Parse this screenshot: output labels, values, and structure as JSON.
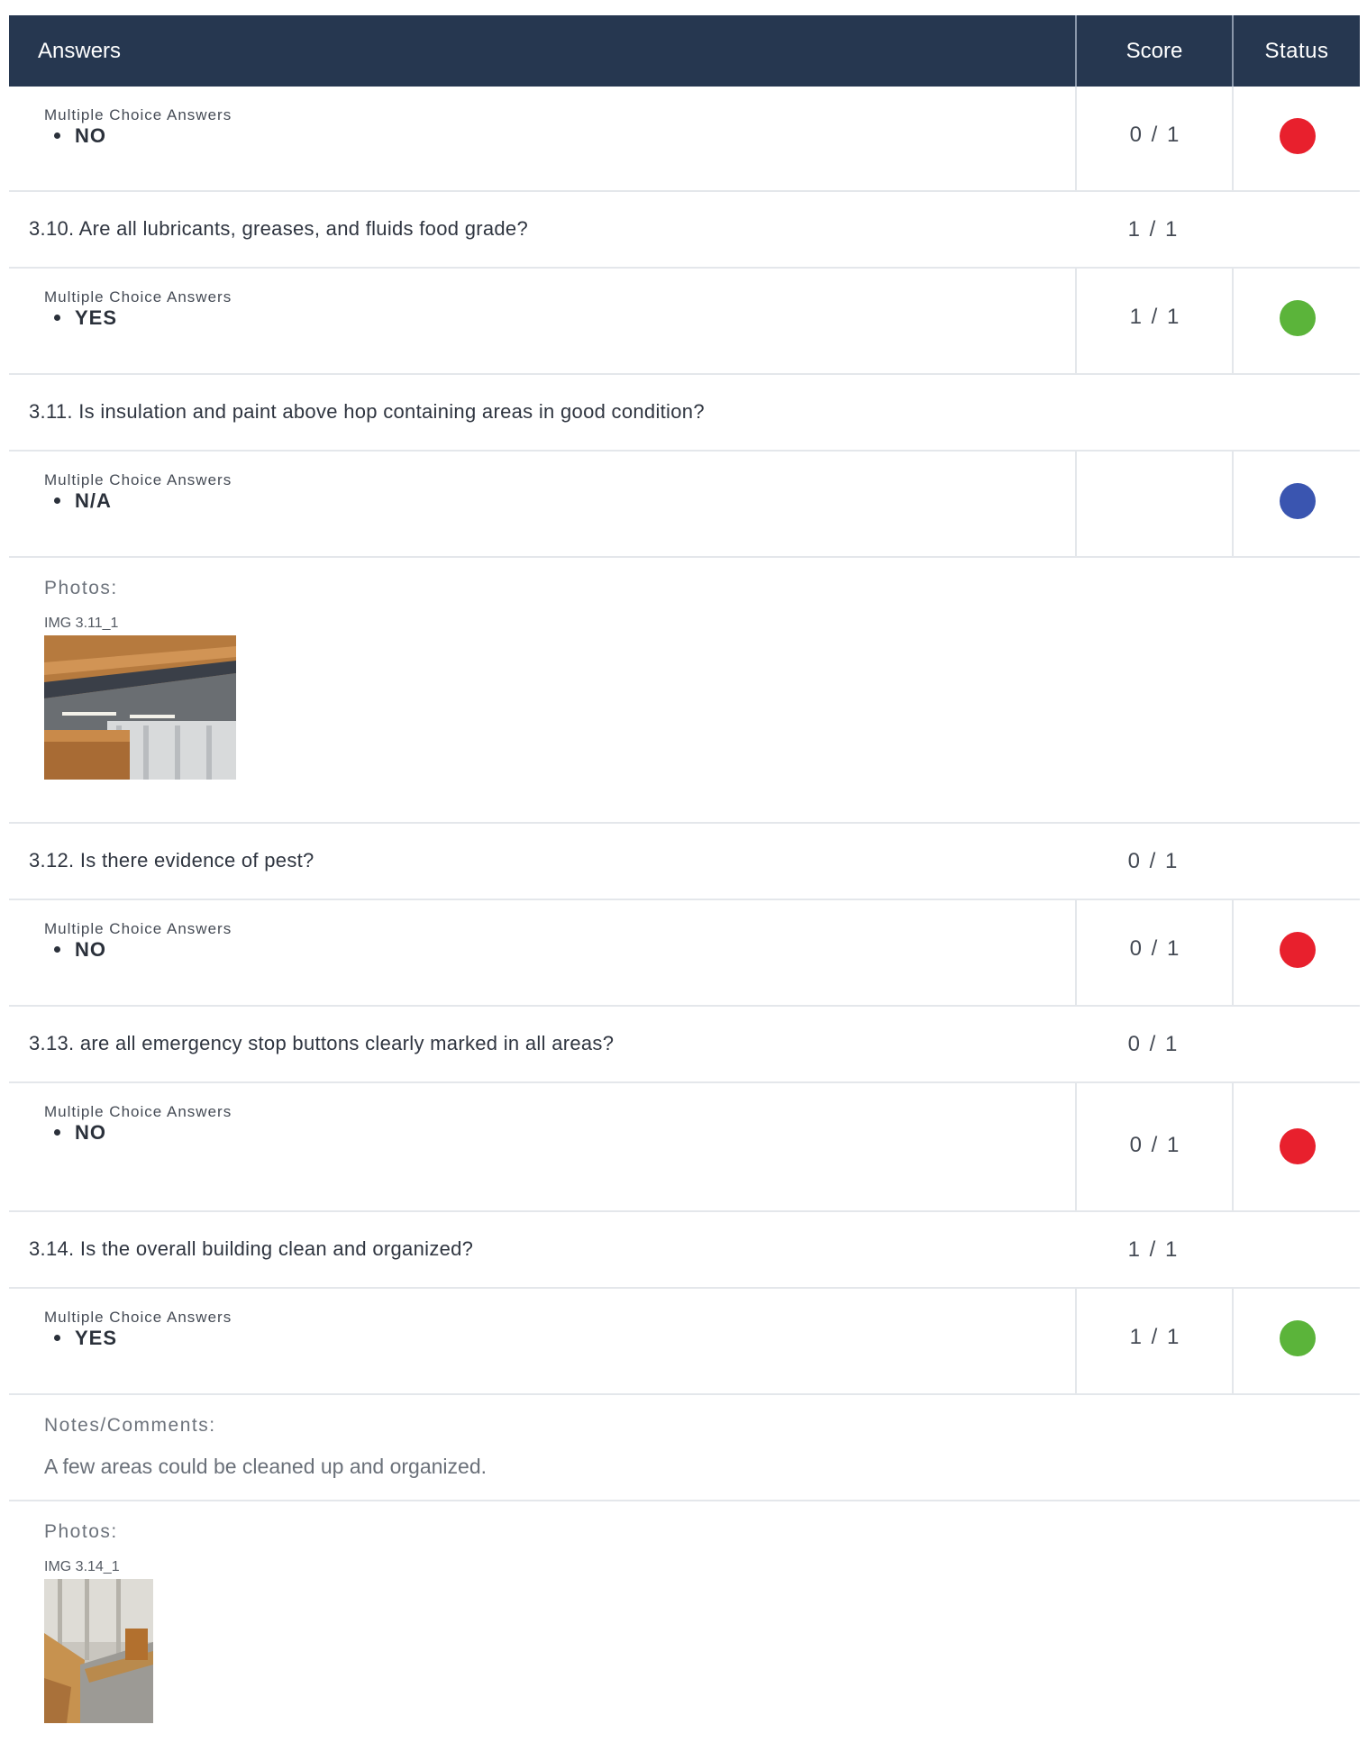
{
  "header": {
    "answers": "Answers",
    "score": "Score",
    "status": "Status"
  },
  "mca_label": "Multiple Choice Answers",
  "colors": {
    "red": "#e8202d",
    "green": "#5bb43a",
    "blue": "#3a55b0",
    "header_bg": "#263750"
  },
  "rows": {
    "a0": {
      "value": "NO",
      "score": "0 / 1",
      "status": "red"
    },
    "q310": {
      "text": "3.10.  Are all lubricants, greases, and fluids food grade?",
      "score": "1 / 1"
    },
    "a310": {
      "value": "YES",
      "score": "1 / 1",
      "status": "green"
    },
    "q311": {
      "text": "3.11.  Is insulation and paint above hop containing areas in good condition?",
      "score": ""
    },
    "a311": {
      "value": "N/A",
      "score": "",
      "status": "blue"
    },
    "photos311": {
      "label": "Photos:",
      "caption": "IMG 3.11_1"
    },
    "q312": {
      "text": "3.12.  Is there evidence of pest?",
      "score": "0 / 1"
    },
    "a312": {
      "value": "NO",
      "score": "0 / 1",
      "status": "red"
    },
    "q313": {
      "text": "3.13.  are all emergency stop buttons clearly marked in all areas?",
      "score": "0 / 1"
    },
    "a313": {
      "value": "NO",
      "score": "0 / 1",
      "status": "red"
    },
    "q314": {
      "text": "3.14.  Is the overall building clean and organized?",
      "score": "1 / 1"
    },
    "a314": {
      "value": "YES",
      "score": "1 / 1",
      "status": "green"
    },
    "notes314": {
      "label": "Notes/Comments:",
      "text": "A few areas could be cleaned up and organized."
    },
    "photos314": {
      "label": "Photos:",
      "caption": "IMG 3.14_1"
    }
  }
}
